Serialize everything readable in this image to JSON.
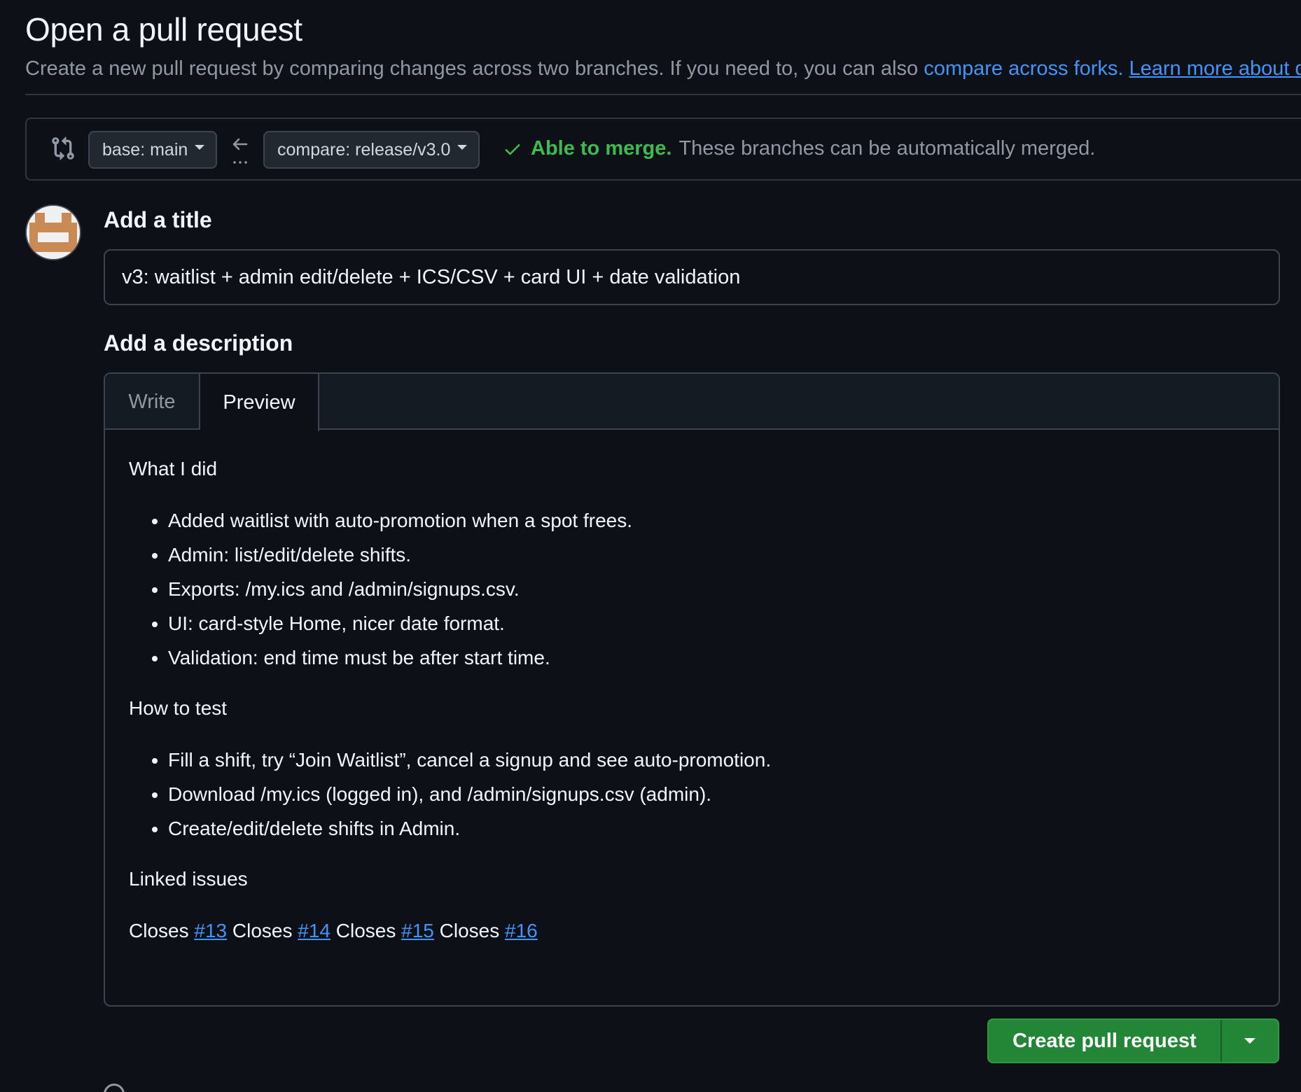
{
  "header": {
    "title": "Open a pull request",
    "subtitle_text": "Create a new pull request by comparing changes across two branches. If you need to, you can also ",
    "compare_forks_link": "compare across forks.",
    "learn_more_link": "Learn more about d"
  },
  "range": {
    "base_label": "base: main",
    "compare_label": "compare: release/v3.0",
    "merge_ok": "Able to merge.",
    "merge_rest": "These branches can be automatically merged."
  },
  "form": {
    "title_label": "Add a title",
    "title_value": "v3: waitlist + admin edit/delete + ICS/CSV + card UI + date validation",
    "description_label": "Add a description",
    "tabs": [
      {
        "label": "Write",
        "active": false
      },
      {
        "label": "Preview",
        "active": true
      }
    ]
  },
  "preview": {
    "what_heading": "What I did",
    "what_items": [
      "Added waitlist with auto-promotion when a spot frees.",
      "Admin: list/edit/delete shifts.",
      "Exports: /my.ics and /admin/signups.csv.",
      "UI: card-style Home, nicer date format.",
      "Validation: end time must be after start time."
    ],
    "test_heading": "How to test",
    "test_items": [
      "Fill a shift, try “Join Waitlist”, cancel a signup and see auto-promotion.",
      "Download /my.ics (logged in), and /admin/signups.csv (admin).",
      "Create/edit/delete shifts in Admin."
    ],
    "linked_heading": "Linked issues",
    "closes_word": "Closes",
    "issues": [
      "#13",
      "#14",
      "#15",
      "#16"
    ]
  },
  "actions": {
    "create_label": "Create pull request"
  },
  "colors": {
    "background": "#0d1117",
    "link": "#4493f8",
    "success": "#3fb950",
    "button_green": "#238636",
    "avatar_brown": "#c98a55"
  },
  "icons": {
    "compare": "git-compare-icon",
    "arrow": "arrow-left-icon",
    "check": "check-icon",
    "caret": "triangle-down-icon"
  }
}
